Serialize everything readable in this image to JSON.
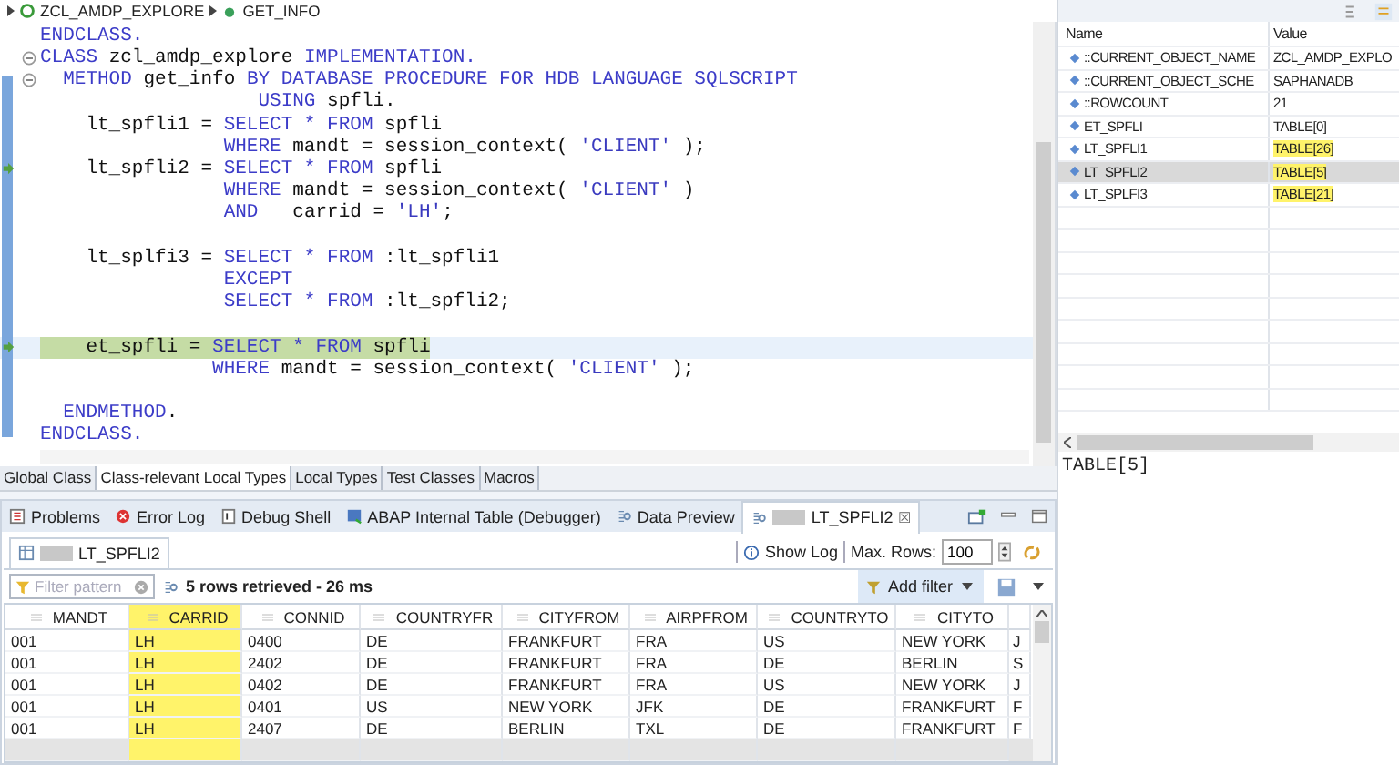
{
  "breadcrumb": [
    "ZCL_AMDP_EXPLORE",
    "GET_INFO"
  ],
  "code_lines": [
    {
      "kind": "plain",
      "highlighted": false,
      "segments": [
        {
          "kind": "keyword",
          "text": "ENDCLASS."
        }
      ]
    },
    {
      "kind": "fold",
      "highlighted": false,
      "segments": [
        {
          "kind": "keyword",
          "text": "CLASS"
        },
        {
          "kind": "plain",
          "text": " zcl_amdp_explore "
        },
        {
          "kind": "keyword",
          "text": "IMPLEMENTATION."
        }
      ]
    },
    {
      "kind": "fold",
      "highlighted": false,
      "segments": [
        {
          "kind": "keyword",
          "text": "  METHOD"
        },
        {
          "kind": "plain",
          "text": " get_info "
        },
        {
          "kind": "keyword",
          "text": "BY DATABASE PROCEDURE FOR HDB LANGUAGE SQLSCRIPT"
        }
      ]
    },
    {
      "kind": "plain",
      "highlighted": false,
      "segments": [
        {
          "kind": "keyword",
          "text": "                   USING"
        },
        {
          "kind": "plain",
          "text": " spfli."
        }
      ]
    },
    {
      "kind": "plain",
      "highlighted": false,
      "segments": [
        {
          "kind": "plain",
          "text": "    lt_spfli1 = "
        },
        {
          "kind": "keyword",
          "text": "SELECT * FROM"
        },
        {
          "kind": "plain",
          "text": " spfli"
        }
      ]
    },
    {
      "kind": "plain",
      "highlighted": false,
      "segments": [
        {
          "kind": "keyword",
          "text": "                WHERE"
        },
        {
          "kind": "plain",
          "text": " mandt = session_context( "
        },
        {
          "kind": "string",
          "text": "'CLIENT'"
        },
        {
          "kind": "plain",
          "text": " );"
        }
      ]
    },
    {
      "kind": "arrow",
      "highlighted": false,
      "segments": [
        {
          "kind": "plain",
          "text": "    lt_spfli2 = "
        },
        {
          "kind": "keyword",
          "text": "SELECT * FROM"
        },
        {
          "kind": "plain",
          "text": " spfli"
        }
      ]
    },
    {
      "kind": "plain",
      "highlighted": false,
      "segments": [
        {
          "kind": "keyword",
          "text": "                WHERE"
        },
        {
          "kind": "plain",
          "text": " mandt = session_context( "
        },
        {
          "kind": "string",
          "text": "'CLIENT'"
        },
        {
          "kind": "plain",
          "text": " )"
        }
      ]
    },
    {
      "kind": "plain",
      "highlighted": false,
      "segments": [
        {
          "kind": "keyword",
          "text": "                AND"
        },
        {
          "kind": "plain",
          "text": "   carrid = "
        },
        {
          "kind": "string",
          "text": "'LH'"
        },
        {
          "kind": "plain",
          "text": ";"
        }
      ]
    },
    {
      "kind": "plain",
      "highlighted": false
    },
    {
      "kind": "plain",
      "highlighted": false,
      "segments": [
        {
          "kind": "plain",
          "text": "    lt_splfi3 = "
        },
        {
          "kind": "keyword",
          "text": "SELECT * FROM"
        },
        {
          "kind": "plain",
          "text": " :lt_spfli1"
        }
      ]
    },
    {
      "kind": "plain",
      "highlighted": false,
      "segments": [
        {
          "kind": "keyword",
          "text": "                EXCEPT"
        }
      ]
    },
    {
      "kind": "plain",
      "highlighted": false,
      "segments": [
        {
          "kind": "keyword",
          "text": "                SELECT * FROM"
        },
        {
          "kind": "plain",
          "text": " :lt_spfli2;"
        }
      ]
    },
    {
      "kind": "plain",
      "highlighted": false
    },
    {
      "kind": "arrow",
      "highlighted": true,
      "segments": [
        {
          "kind": "plain",
          "text": "    et_spfli = "
        },
        {
          "kind": "keyword",
          "text": "SELECT * FROM"
        },
        {
          "kind": "plain",
          "text": " spfli"
        }
      ]
    },
    {
      "kind": "plain",
      "highlighted": false,
      "segments": [
        {
          "kind": "keyword",
          "text": "               WHERE"
        },
        {
          "kind": "plain",
          "text": " mandt = session_context( "
        },
        {
          "kind": "string",
          "text": "'CLIENT'"
        },
        {
          "kind": "plain",
          "text": " );"
        }
      ]
    },
    {
      "kind": "plain",
      "highlighted": false
    },
    {
      "kind": "plain",
      "highlighted": false,
      "segments": [
        {
          "kind": "keyword",
          "text": "  ENDMETHOD"
        },
        {
          "kind": "plain",
          "text": "."
        }
      ]
    },
    {
      "kind": "plain",
      "highlighted": false,
      "segments": [
        {
          "kind": "keyword",
          "text": "ENDCLASS."
        }
      ]
    }
  ],
  "editor_tabs": [
    {
      "label": "Global Class",
      "selected": false
    },
    {
      "label": "Class-relevant Local Types",
      "selected": true
    },
    {
      "label": "Local Types",
      "selected": false
    },
    {
      "label": "Test Classes",
      "selected": false
    },
    {
      "label": "Macros",
      "selected": false
    }
  ],
  "bottom_tabs": [
    {
      "label": "Problems",
      "selected": false
    },
    {
      "label": "Error Log",
      "selected": false
    },
    {
      "label": "Debug Shell",
      "selected": false
    },
    {
      "label": "ABAP Internal Table (Debugger)",
      "selected": false
    },
    {
      "label": "Data Preview",
      "selected": false
    },
    {
      "label": "LT_SPFLI2",
      "selected": true,
      "close": "☒"
    }
  ],
  "preview": {
    "tab": "LT_SPFLI2",
    "show_log": "Show Log",
    "max_rows_label": "Max. Rows:",
    "max_rows": "100",
    "filter_placeholder": "Filter pattern",
    "status": "5 rows retrieved - 26 ms",
    "add_filter": "Add filter",
    "columns": [
      {
        "label": "MANDT",
        "highlighted": false
      },
      {
        "label": "CARRID",
        "highlighted": true
      },
      {
        "label": "CONNID",
        "highlighted": false
      },
      {
        "label": "COUNTRYFR",
        "highlighted": false
      },
      {
        "label": "CITYFROM",
        "highlighted": false
      },
      {
        "label": "AIRPFROM",
        "highlighted": false
      },
      {
        "label": "COUNTRYTO",
        "highlighted": false
      },
      {
        "label": "CITYTO",
        "highlighted": false
      }
    ],
    "rows": [
      [
        "001",
        "LH",
        "0400",
        "DE",
        "FRANKFURT",
        "FRA",
        "US",
        "NEW YORK",
        "J"
      ],
      [
        "001",
        "LH",
        "2402",
        "DE",
        "FRANKFURT",
        "FRA",
        "DE",
        "BERLIN",
        "S"
      ],
      [
        "001",
        "LH",
        "0402",
        "DE",
        "FRANKFURT",
        "FRA",
        "US",
        "NEW YORK",
        "J"
      ],
      [
        "001",
        "LH",
        "0401",
        "US",
        "NEW YORK",
        "JFK",
        "DE",
        "FRANKFURT",
        "F"
      ],
      [
        "001",
        "LH",
        "2407",
        "DE",
        "BERLIN",
        "TXL",
        "DE",
        "FRANKFURT",
        "F"
      ]
    ]
  },
  "variables": {
    "columns": [
      "Name",
      "Value"
    ],
    "rows": [
      {
        "name": "::CURRENT_OBJECT_NAME",
        "value": "ZCL_AMDP_EXPLO",
        "highlighted": false,
        "selected": false
      },
      {
        "name": "::CURRENT_OBJECT_SCHE",
        "value": "SAPHANADB",
        "highlighted": false,
        "selected": false
      },
      {
        "name": "::ROWCOUNT",
        "value": "21",
        "highlighted": false,
        "selected": false
      },
      {
        "name": "ET_SPFLI",
        "value": "TABLE[0]",
        "highlighted": false,
        "selected": false
      },
      {
        "name": "LT_SPFLI1",
        "value": "TABLE[26]",
        "highlighted": true,
        "selected": false
      },
      {
        "name": "LT_SPFLI2",
        "value": "TABLE[5]",
        "highlighted": true,
        "selected": true
      },
      {
        "name": "LT_SPLFI3",
        "value": "TABLE[21]",
        "highlighted": true,
        "selected": false
      }
    ],
    "detail": "TABLE[5]"
  }
}
